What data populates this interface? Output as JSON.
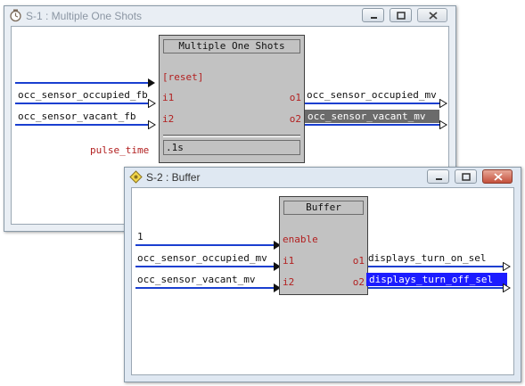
{
  "window1": {
    "title": "S-1 : Multiple One Shots",
    "block": {
      "title": "Multiple One Shots",
      "ports": {
        "reset": "[reset]",
        "i1": "i1",
        "i2": "i2",
        "o1": "o1",
        "o2": "o2"
      },
      "field_value": ".1s"
    },
    "inputs": {
      "i1": "occ_sensor_occupied_fb",
      "i2": "occ_sensor_vacant_fb",
      "pulse_time": "pulse_time"
    },
    "outputs": {
      "o1": "occ_sensor_occupied_mv",
      "o2": "occ_sensor_vacant_mv"
    }
  },
  "window2": {
    "title": "S-2 : Buffer",
    "block": {
      "title": "Buffer",
      "ports": {
        "enable": "enable",
        "i1": "i1",
        "i2": "i2",
        "o1": "o1",
        "o2": "o2"
      }
    },
    "inputs": {
      "enable": "1",
      "i1": "occ_sensor_occupied_mv",
      "i2": "occ_sensor_vacant_mv"
    },
    "outputs": {
      "o1": "displays_turn_on_sel",
      "o2": "displays_turn_off_sel"
    }
  },
  "colors": {
    "wire": "#1a3fd0",
    "port_label": "#b22020",
    "selection_blue": "#1c1cff",
    "selection_grey": "#6b6b6b"
  },
  "icons": {
    "window1": "clock-icon",
    "window2": "buffer-diamond-icon"
  }
}
